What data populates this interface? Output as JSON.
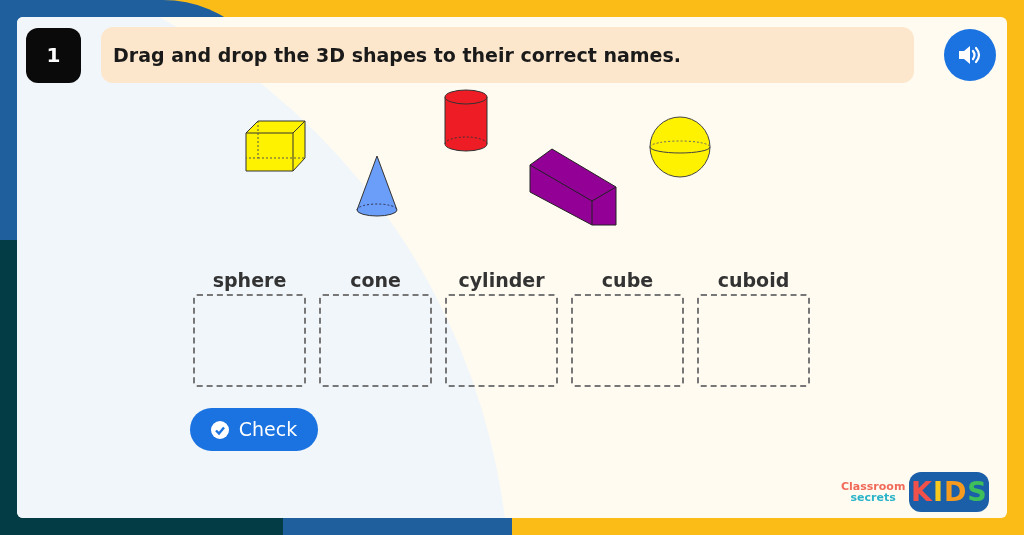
{
  "question": {
    "number": "1",
    "prompt": "Drag and drop the 3D shapes to their correct names."
  },
  "drop_zones": [
    {
      "label": "sphere"
    },
    {
      "label": "cone"
    },
    {
      "label": "cylinder"
    },
    {
      "label": "cube"
    },
    {
      "label": "cuboid"
    }
  ],
  "check_button": {
    "label": "Check"
  },
  "logo": {
    "line_1": "Classroom",
    "line_2": "secrets",
    "badge": "KIDS"
  }
}
